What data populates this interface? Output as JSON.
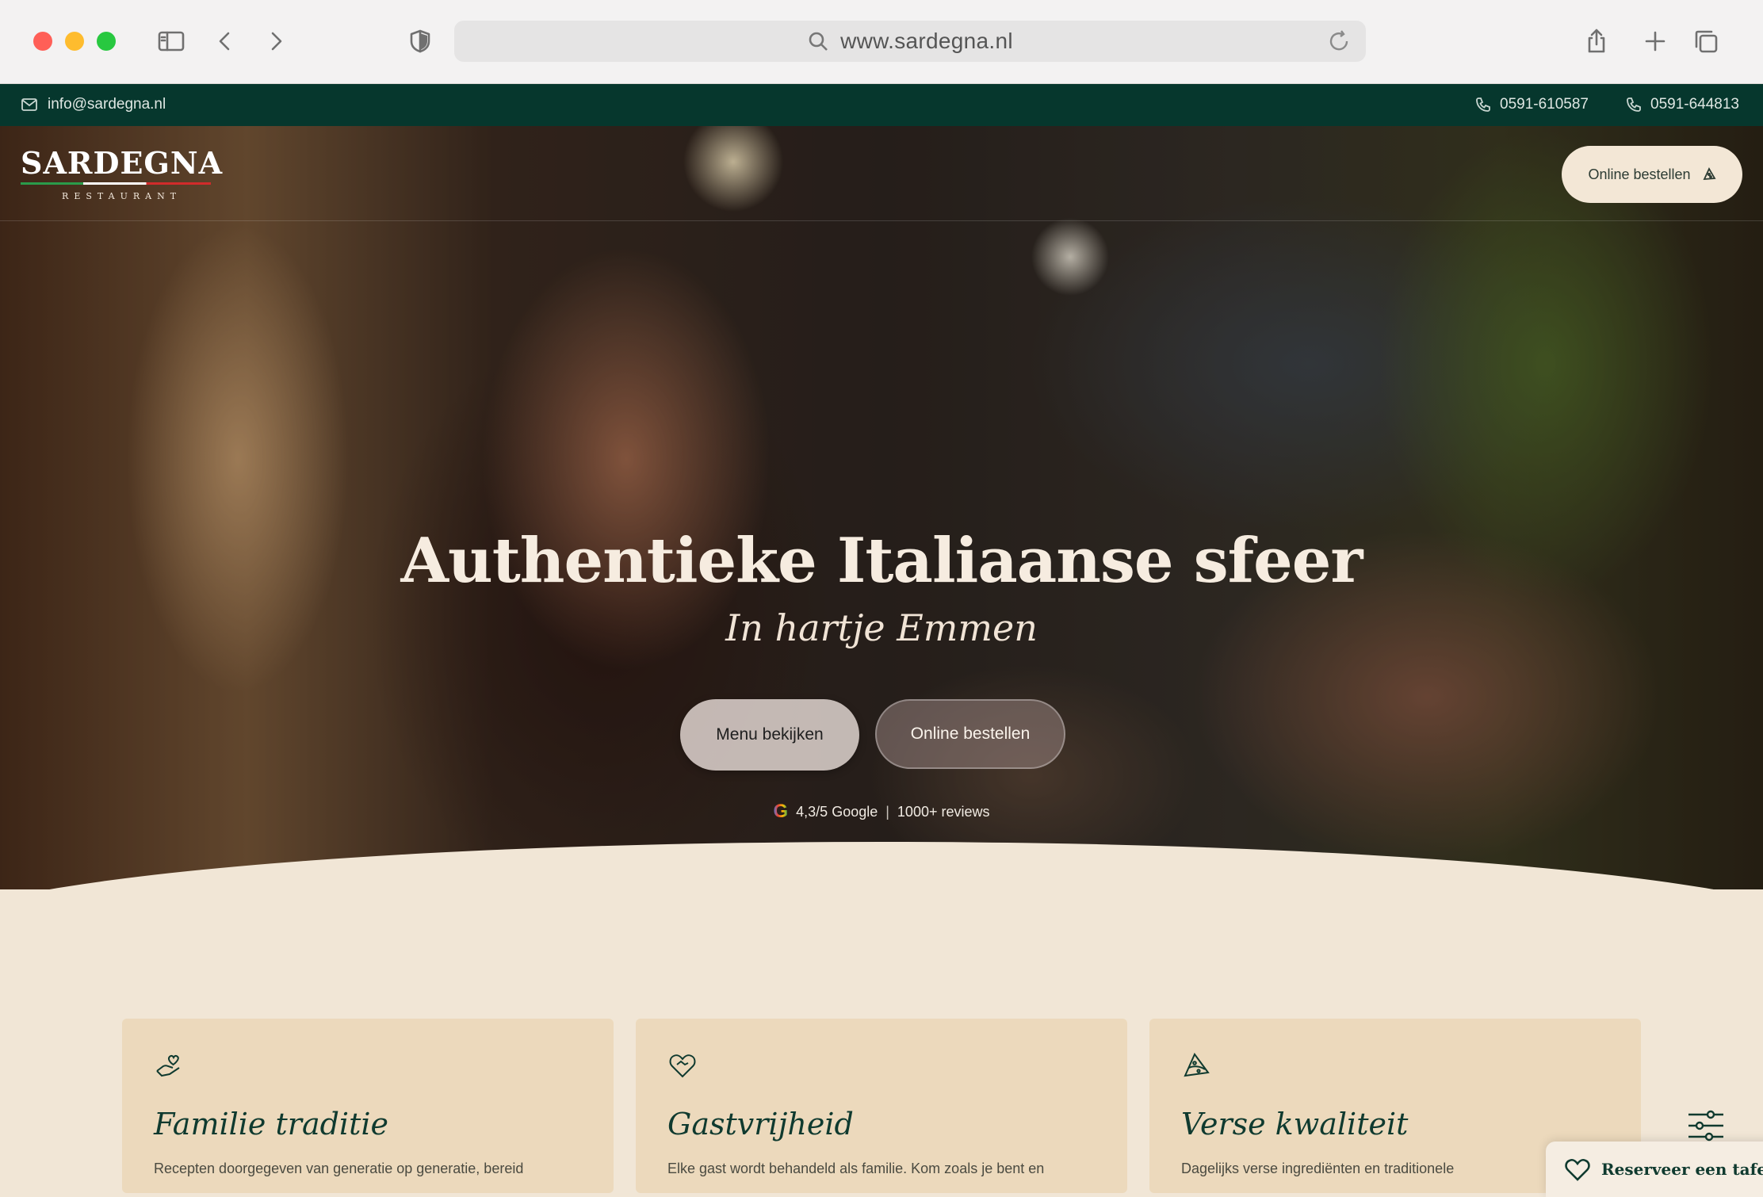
{
  "browser": {
    "url": "www.sardegna.nl"
  },
  "topbar": {
    "email": "info@sardegna.nl",
    "phone1": "0591-610587",
    "phone2": "0591-644813"
  },
  "header": {
    "logo_name": "SARDEGNA",
    "logo_sub": "RESTAURANT",
    "order_button": "Online bestellen"
  },
  "hero": {
    "title": "Authentieke Italiaanse sfeer",
    "subtitle": "In hartje Emmen",
    "menu_button": "Menu bekijken",
    "order_button": "Online bestellen",
    "rating_text": "4,3/5 Google",
    "rating_separator": "|",
    "reviews": "1000+ reviews"
  },
  "cards": [
    {
      "icon": "hand-heart-icon",
      "title": "Familie traditie",
      "desc": "Recepten doorgegeven van generatie op generatie, bereid"
    },
    {
      "icon": "heart-handshake-icon",
      "title": "Gastvrijheid",
      "desc": "Elke gast wordt behandeld als familie. Kom zoals je bent en"
    },
    {
      "icon": "pizza-slice-icon",
      "title": "Verse kwaliteit",
      "desc": "Dagelijks verse ingrediënten en traditionele"
    }
  ],
  "floating": {
    "reserve_label": "Reserveer een tafel"
  },
  "colors": {
    "dark_green": "#06372d",
    "cream": "#f1e6d6",
    "card": "#ecd9bc"
  }
}
